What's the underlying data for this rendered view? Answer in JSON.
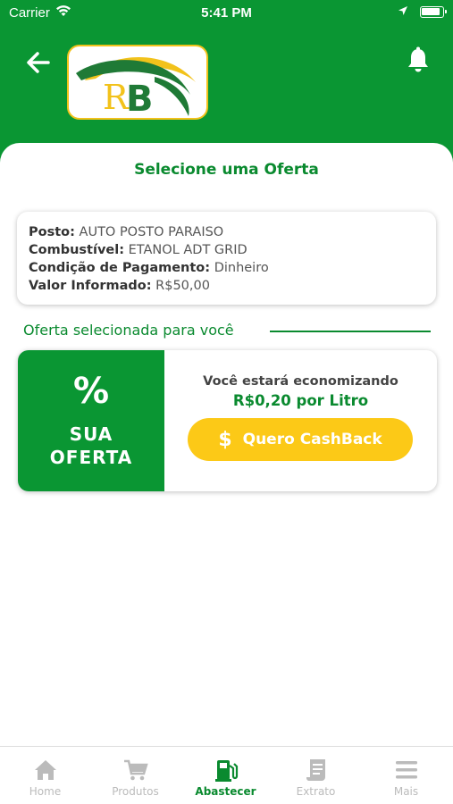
{
  "status_bar": {
    "carrier": "Carrier",
    "time": "5:41 PM"
  },
  "header": {
    "logo_text": "RB"
  },
  "page": {
    "title": "Selecione uma Oferta"
  },
  "info": {
    "posto_label": "Posto:",
    "posto_value": "AUTO POSTO PARAISO",
    "combustivel_label": "Combustível:",
    "combustivel_value": "ETANOL ADT GRID",
    "pagamento_label": "Condição de Pagamento:",
    "pagamento_value": "Dinheiro",
    "valor_label": "Valor Informado:",
    "valor_value": "R$50,00"
  },
  "section": {
    "label": "Oferta selecionada para você"
  },
  "offer": {
    "percent": "%",
    "label_line1": "SUA",
    "label_line2": "OFERTA",
    "saving_text": "Você estará economizando",
    "saving_value": "R$0,20 por Litro",
    "button_icon": "$",
    "button_label": "Quero CashBack"
  },
  "tabs": [
    {
      "label": "Home",
      "icon": "home-icon"
    },
    {
      "label": "Produtos",
      "icon": "cart-icon"
    },
    {
      "label": "Abastecer",
      "icon": "fuel-pump-icon",
      "active": true
    },
    {
      "label": "Extrato",
      "icon": "receipt-icon"
    },
    {
      "label": "Mais",
      "icon": "menu-icon"
    }
  ],
  "colors": {
    "primary_green": "#0a9633",
    "accent_yellow": "#fcc917",
    "inactive_gray": "#bbbbbb"
  }
}
